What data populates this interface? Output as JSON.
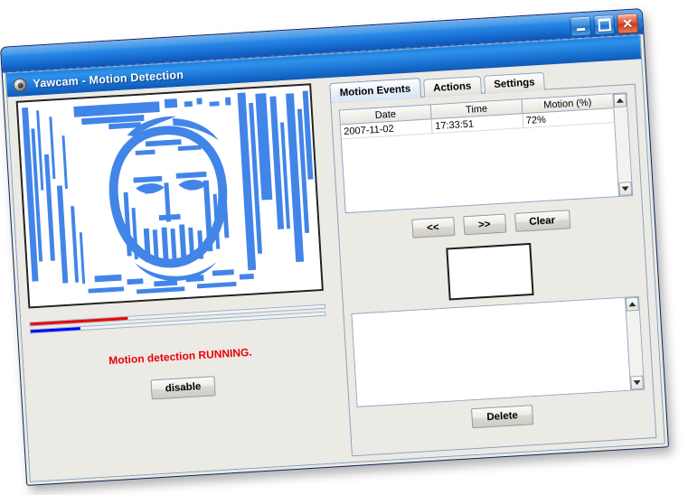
{
  "window": {
    "title": "Yawcam - Motion Detection",
    "icon": "webcam-icon",
    "controls": {
      "minimize": "minimize-icon",
      "maximize": "maximize-icon",
      "close": "close-icon"
    }
  },
  "app": {
    "title": "Yawcam - Motion Detection"
  },
  "left_pane": {
    "video_alt": "motion-detection-mask",
    "bars": [
      {
        "name": "motion-level-bar",
        "color": "#ee0000",
        "percent": 33
      },
      {
        "name": "threshold-level-bar",
        "color": "#0000ee",
        "percent": 17
      }
    ],
    "status_text": "Motion detection RUNNING.",
    "status_color": "#e8000a",
    "disable_button": "disable"
  },
  "tabs": [
    {
      "label": "Motion Events",
      "active": true
    },
    {
      "label": "Actions",
      "active": false
    },
    {
      "label": "Settings",
      "active": false
    }
  ],
  "events_table": {
    "columns": [
      "Date",
      "Time",
      "Motion (%)"
    ],
    "rows": [
      [
        "2007-11-02",
        "17:33:51",
        "72%"
      ]
    ]
  },
  "nav_buttons": {
    "prev": "<<",
    "next": ">>",
    "clear": "Clear"
  },
  "preview": {
    "name": "event-preview-thumbnail"
  },
  "detail_list": {
    "items": []
  },
  "delete_button": "Delete",
  "scrollbars": {
    "up_arrow": "scroll-up-icon",
    "down_arrow": "scroll-down-icon"
  },
  "colors": {
    "title_blue": "#1f7ee0",
    "motion_mask_blue": "#4285e8",
    "status_red": "#e8000a",
    "panel_grey": "#eceae4"
  }
}
